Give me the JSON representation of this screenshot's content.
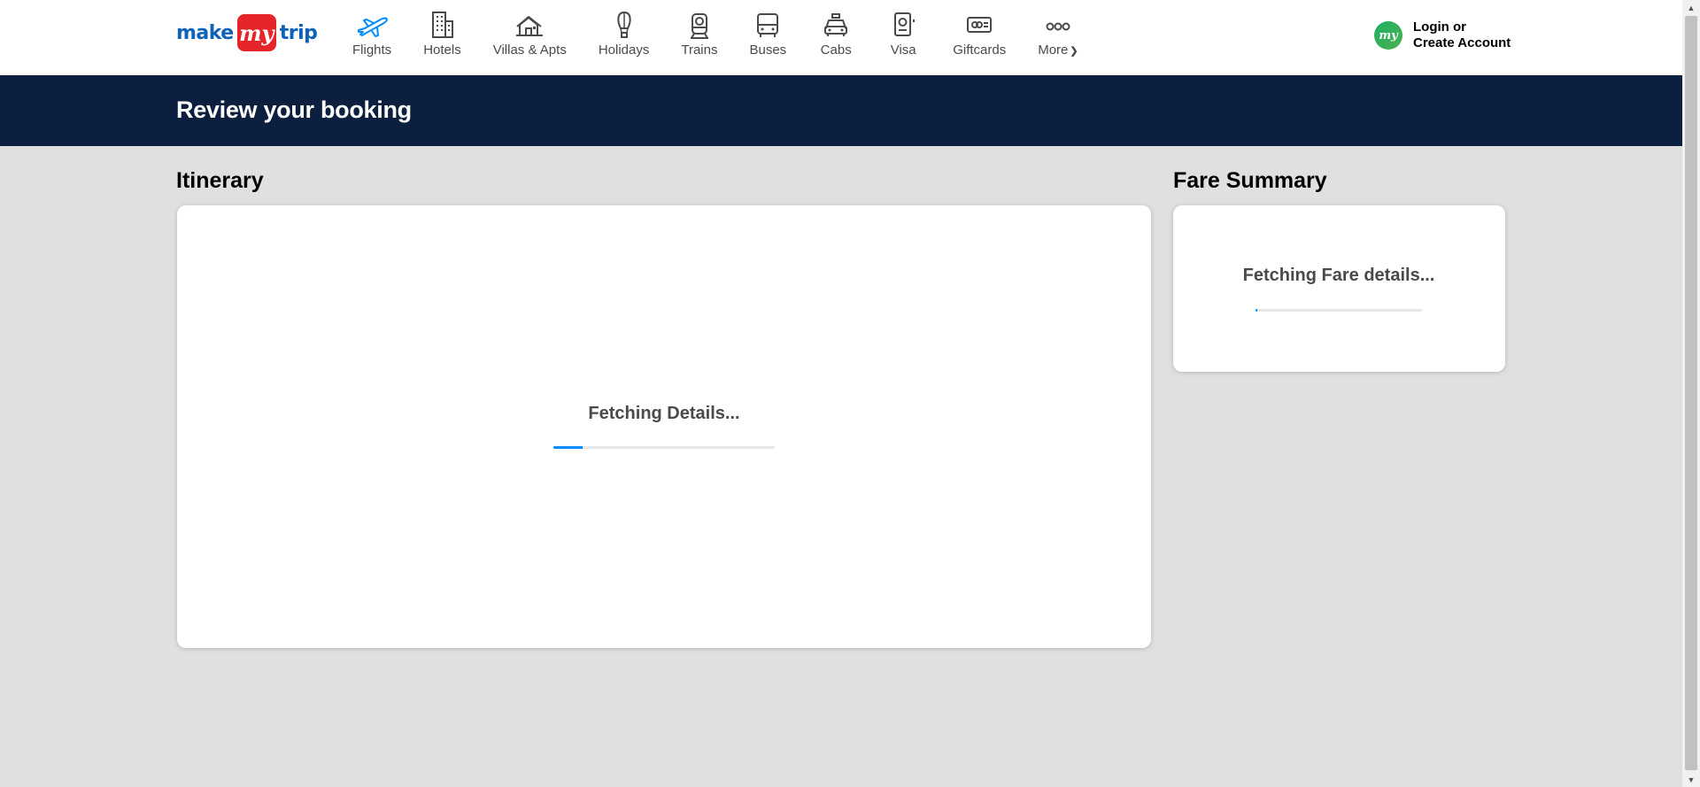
{
  "header": {
    "logo": {
      "part1": "make",
      "part2": "my",
      "part3": "trip"
    },
    "nav": [
      {
        "label": "Flights",
        "icon": "plane-icon"
      },
      {
        "label": "Hotels",
        "icon": "building-icon"
      },
      {
        "label": "Villas & Apts",
        "icon": "house-icon"
      },
      {
        "label": "Holidays",
        "icon": "hot-air-balloon-icon"
      },
      {
        "label": "Trains",
        "icon": "train-icon"
      },
      {
        "label": "Buses",
        "icon": "bus-icon"
      },
      {
        "label": "Cabs",
        "icon": "taxi-icon"
      },
      {
        "label": "Visa",
        "icon": "passport-icon"
      },
      {
        "label": "Giftcards",
        "icon": "giftcard-icon"
      },
      {
        "label": "More",
        "icon": "more-dots-icon"
      }
    ],
    "account": {
      "avatar": "my",
      "line1": "Login or",
      "line2": "Create Account"
    }
  },
  "banner": {
    "title": "Review your booking"
  },
  "itinerary": {
    "title": "Itinerary",
    "loading_text": "Fetching Details...",
    "progress": 0.13
  },
  "fare_summary": {
    "title": "Fare Summary",
    "loading_text": "Fetching Fare details...",
    "progress": 0.01
  },
  "colors": {
    "brand_blue": "#0e62b7",
    "brand_red": "#e5252a",
    "banner_navy": "#0c1f3f",
    "progress_blue": "#008cff",
    "page_bg": "#e0e0e0"
  }
}
